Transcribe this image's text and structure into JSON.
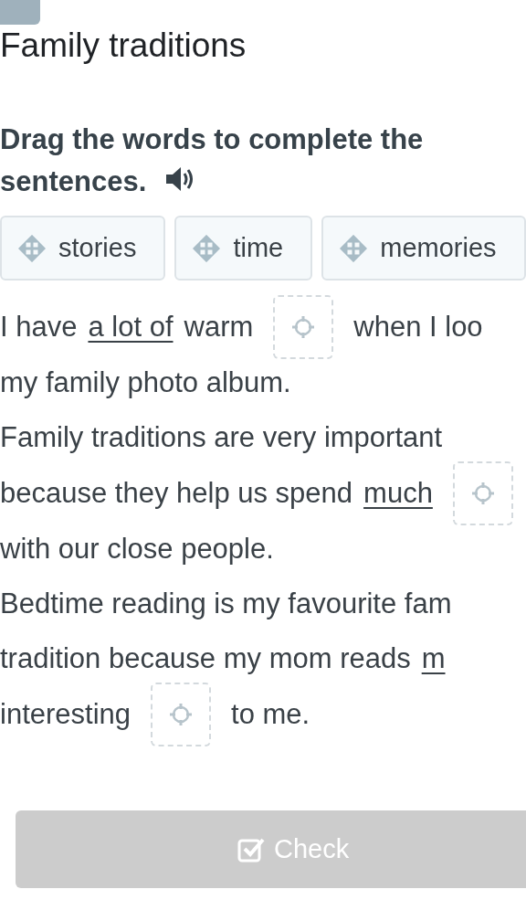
{
  "title": "Family traditions",
  "instruction": "Drag the words to complete the sentences.",
  "words": [
    "stories",
    "time",
    "memories"
  ],
  "sentences": [
    {
      "lines": [
        [
          {
            "kind": "text",
            "text": "I have"
          },
          {
            "kind": "underline",
            "text": "a lot of"
          },
          {
            "kind": "text",
            "text": "warm"
          },
          {
            "kind": "blank"
          },
          {
            "kind": "text",
            "text": "when I loo"
          }
        ],
        [
          {
            "kind": "text",
            "text": "my family photo album."
          }
        ]
      ]
    },
    {
      "lines": [
        [
          {
            "kind": "text",
            "text": "Family traditions are very important"
          }
        ],
        [
          {
            "kind": "text",
            "text": "because they help us spend"
          },
          {
            "kind": "underline",
            "text": "much"
          },
          {
            "kind": "blank"
          }
        ],
        [
          {
            "kind": "text",
            "text": "with our close people."
          }
        ]
      ]
    },
    {
      "lines": [
        [
          {
            "kind": "text",
            "text": "Bedtime reading is my favourite fam"
          }
        ],
        [
          {
            "kind": "text",
            "text": "tradition because my mom reads"
          },
          {
            "kind": "underline",
            "text": "m"
          }
        ],
        [
          {
            "kind": "text",
            "text": "interesting"
          },
          {
            "kind": "blank"
          },
          {
            "kind": "text",
            "text": "to me."
          }
        ]
      ]
    }
  ],
  "check_button": {
    "label": "Check",
    "disabled": true
  }
}
